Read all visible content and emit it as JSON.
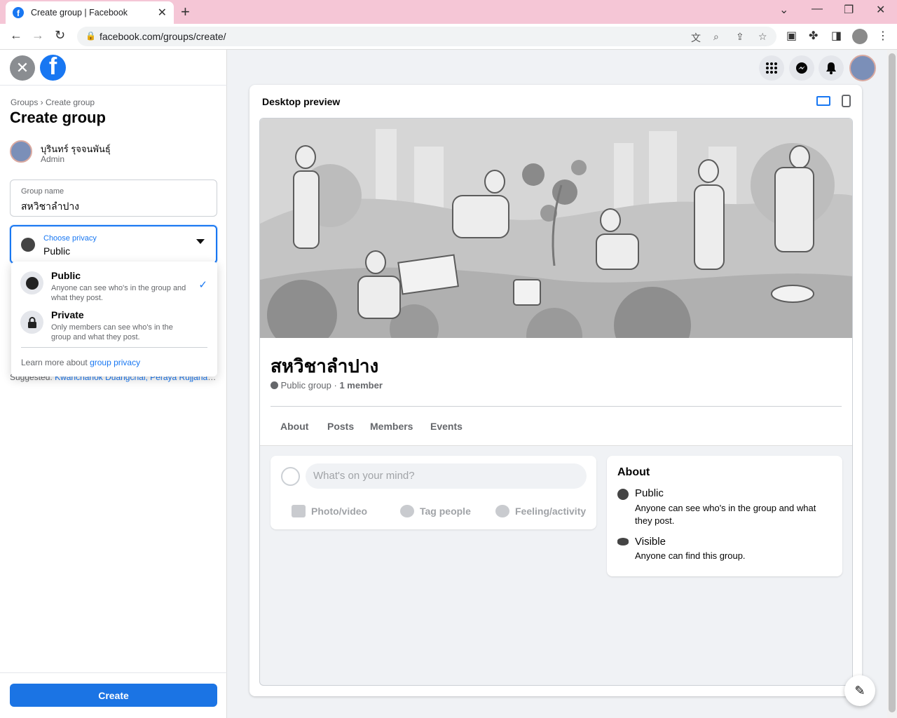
{
  "browser": {
    "tab_title": "Create group | Facebook",
    "favicon_letter": "f",
    "tab_close": "✕",
    "new_tab": "+",
    "url": "facebook.com/groups/create/",
    "controls": {
      "minimize": "—",
      "restore": "❐",
      "close": "✕",
      "tabsearch": "⌄"
    }
  },
  "left": {
    "close_icon": "✕",
    "logo_letter": "f",
    "breadcrumb": "Groups › Create group",
    "title": "Create group",
    "admin": {
      "name": "บุรินทร์ รุจจนพันธุ์",
      "role": "Admin"
    },
    "group_name": {
      "label": "Group name",
      "value": "สหวิชาลำปาง"
    },
    "privacy": {
      "label": "Choose privacy",
      "value": "Public"
    },
    "dropdown": {
      "options": [
        {
          "title": "Public",
          "desc": "Anyone can see who's in the group and what they post.",
          "selected": true
        },
        {
          "title": "Private",
          "desc": "Only members can see who's in the group and what they post.",
          "selected": false
        }
      ],
      "learn_prefix": "Learn more about ",
      "learn_link": "group privacy"
    },
    "suggested": {
      "prefix": "Suggested: ",
      "names": "Kwanchanok Duangchai, Peraya Rujjanapan..."
    },
    "create_label": "Create"
  },
  "preview": {
    "title": "Desktop preview",
    "group_name": "สหวิชาลำปาง",
    "meta_type": "Public group",
    "meta_sep": " · ",
    "meta_members": "1 member",
    "tabs": [
      "About",
      "Posts",
      "Members",
      "Events"
    ],
    "composer": {
      "placeholder": "What's on your mind?",
      "actions": [
        "Photo/video",
        "Tag people",
        "Feeling/activity"
      ]
    },
    "about": {
      "heading": "About",
      "items": [
        {
          "title": "Public",
          "desc": "Anyone can see who's in the group and what they post."
        },
        {
          "title": "Visible",
          "desc": "Anyone can find this group."
        }
      ]
    }
  },
  "colors": {
    "accent": "#1877f2",
    "create_button": "#1b74e4",
    "tab_bar": "#f5c6d6"
  }
}
